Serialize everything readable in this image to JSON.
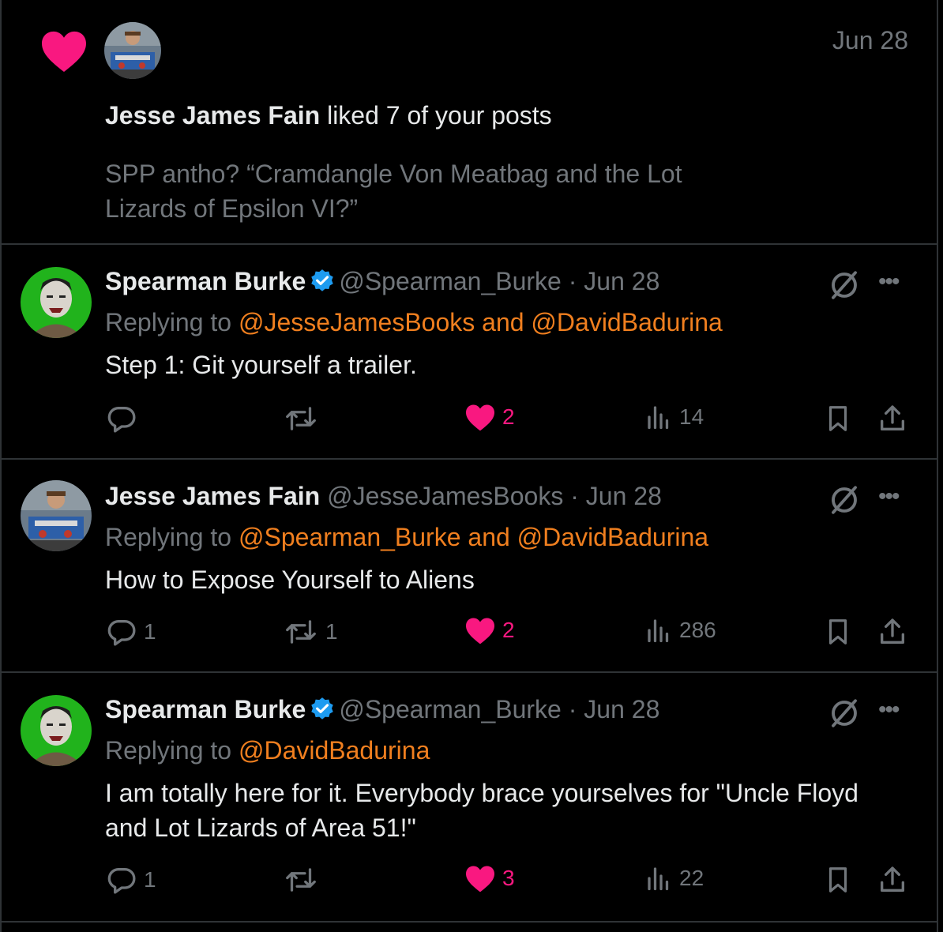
{
  "notification": {
    "actor": "Jesse James Fain",
    "action": "liked 7 of your posts",
    "date": "Jun 28",
    "preview": "SPP antho? “Cramdangle Von Meatbag and the Lot Lizards of Epsilon VI?”"
  },
  "tweets": [
    {
      "name": "Spearman Burke",
      "handle": "@Spearman_Burke",
      "date": "· Jun 28",
      "reply_prefix": "Replying to",
      "reply_to": "@JesseJamesBooks and @DavidBadurina",
      "text": "Step 1: Git yourself a trailer.",
      "replies": "",
      "retweets": "",
      "likes": "2",
      "views": "14"
    },
    {
      "name": "Jesse James Fain",
      "handle": "@JesseJamesBooks",
      "date": "· Jun 28",
      "reply_prefix": "Replying to",
      "reply_to": "@Spearman_Burke and @DavidBadurina",
      "text": "How to Expose Yourself to Aliens",
      "replies": "1",
      "retweets": "1",
      "likes": "2",
      "views": "286"
    },
    {
      "name": "Spearman Burke",
      "handle": "@Spearman_Burke",
      "date": "· Jun 28",
      "reply_prefix": "Replying to",
      "reply_to": "@DavidBadurina",
      "text": "I am totally here for it. Everybody brace yourselves for  \"Uncle Floyd and Lot Lizards of Area 51!\"",
      "replies": "1",
      "retweets": "",
      "likes": "3",
      "views": "22"
    }
  ],
  "more_label": "•••",
  "colors": {
    "like": "#f91880",
    "mention": "#f07f1f",
    "verified": "#1d9bf0",
    "muted": "#71767b",
    "divider": "#2f3336"
  }
}
